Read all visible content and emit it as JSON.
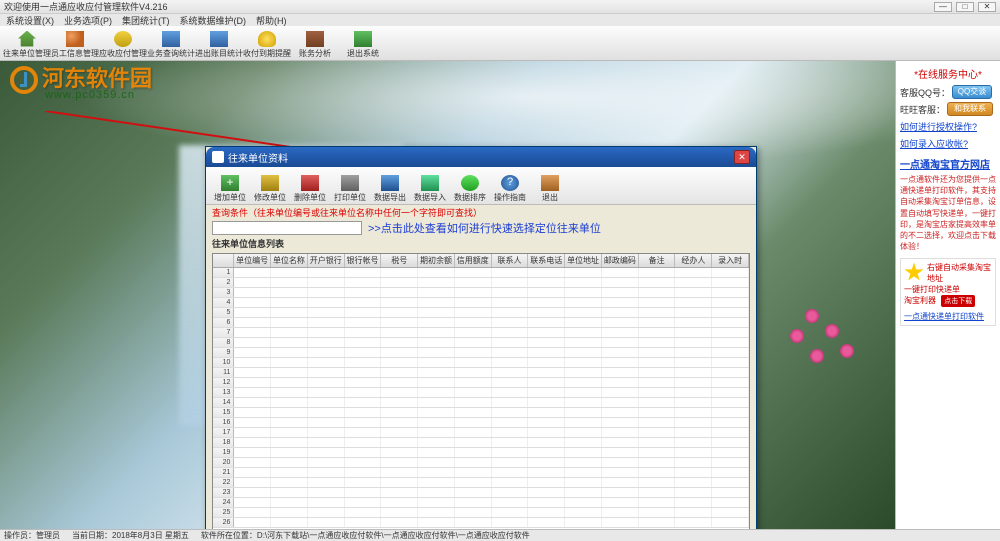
{
  "window": {
    "title": "欢迎使用一点通应收应付管理软件V4.216",
    "buttons": {
      "min": "—",
      "max": "□",
      "close": "✕"
    }
  },
  "menu": [
    "系统设置(X)",
    "业务选项(P)",
    "集团统计(T)",
    "系统数据维护(D)",
    "帮助(H)"
  ],
  "toolbar": [
    {
      "label": "往来单位管理",
      "icon": "ic-house"
    },
    {
      "label": "员工信息管理",
      "icon": "ic-people"
    },
    {
      "label": "应收应付管理",
      "icon": "ic-money"
    },
    {
      "label": "业务查询统计",
      "icon": "ic-chart"
    },
    {
      "label": "进出账目统计",
      "icon": "ic-chart"
    },
    {
      "label": "收付到期提醒",
      "icon": "ic-bulb"
    },
    {
      "label": "账务分析",
      "icon": "ic-book"
    },
    {
      "label": "退出系统",
      "icon": "ic-exit"
    }
  ],
  "watermark": {
    "brand": "河东软件园",
    "url": "www.pc0359.cn"
  },
  "modal": {
    "title": "往来单位资料",
    "close": "✕",
    "toolbar": [
      {
        "label": "增加单位",
        "icon": "ic-add"
      },
      {
        "label": "修改单位",
        "icon": "ic-edit"
      },
      {
        "label": "删除单位",
        "icon": "ic-del"
      },
      {
        "label": "打印单位",
        "icon": "ic-print"
      },
      {
        "label": "数据导出",
        "icon": "ic-export"
      },
      {
        "label": "数据导入",
        "icon": "ic-import"
      },
      {
        "label": "数据排序",
        "icon": "ic-sort"
      },
      {
        "label": "操作指南",
        "icon": "ic-help"
      },
      {
        "label": "退出",
        "icon": "ic-back"
      }
    ],
    "query_label": "查询条件（往来单位编号或往来单位名称中任何一个字符即可查找）",
    "search_value": "",
    "tip_link": ">>点击此处查看如何进行快速选择定位往来单位",
    "list_label": "往来单位信息列表",
    "columns": [
      "单位编号",
      "单位名称",
      "开户银行",
      "银行帐号",
      "税号",
      "期初余额",
      "信用额度",
      "联系人",
      "联系电话",
      "单位地址",
      "邮政编码",
      "备注",
      "经办人",
      "录入时"
    ],
    "row_count": 26
  },
  "side": {
    "title": "*在线服务中心*",
    "qq_label": "客服QQ号：",
    "qq_btn": "QQ交谈",
    "ww_label": "旺旺客服：",
    "ww_btn": "和我联系",
    "links": [
      "如何进行授权操作?",
      "如何录入应收帐?"
    ],
    "shop_link": "一点通淘宝官方网店",
    "desc": "一点通软件还为您提供一点通快递单打印软件，其支持自动采集淘宝订单信息，设置自动填写快递单，一键打印，是淘宝店家提高效率单的不二选择，欢迎点击下载体验！",
    "ad": {
      "line1": "右键自动采集淘宝地址",
      "line2": "一键打印快递单",
      "brand": "淘宝利器",
      "dl": "点击下载",
      "bottom": "一点通快递单打印软件"
    }
  },
  "status": {
    "operator": "操作员：管理员",
    "date": "当前日期：2018年8月3日  星期五",
    "path": "软件所在位置：D:\\河东下载站\\一点通应收应付软件\\一点通应收应付软件\\一点通应收应付软件"
  }
}
